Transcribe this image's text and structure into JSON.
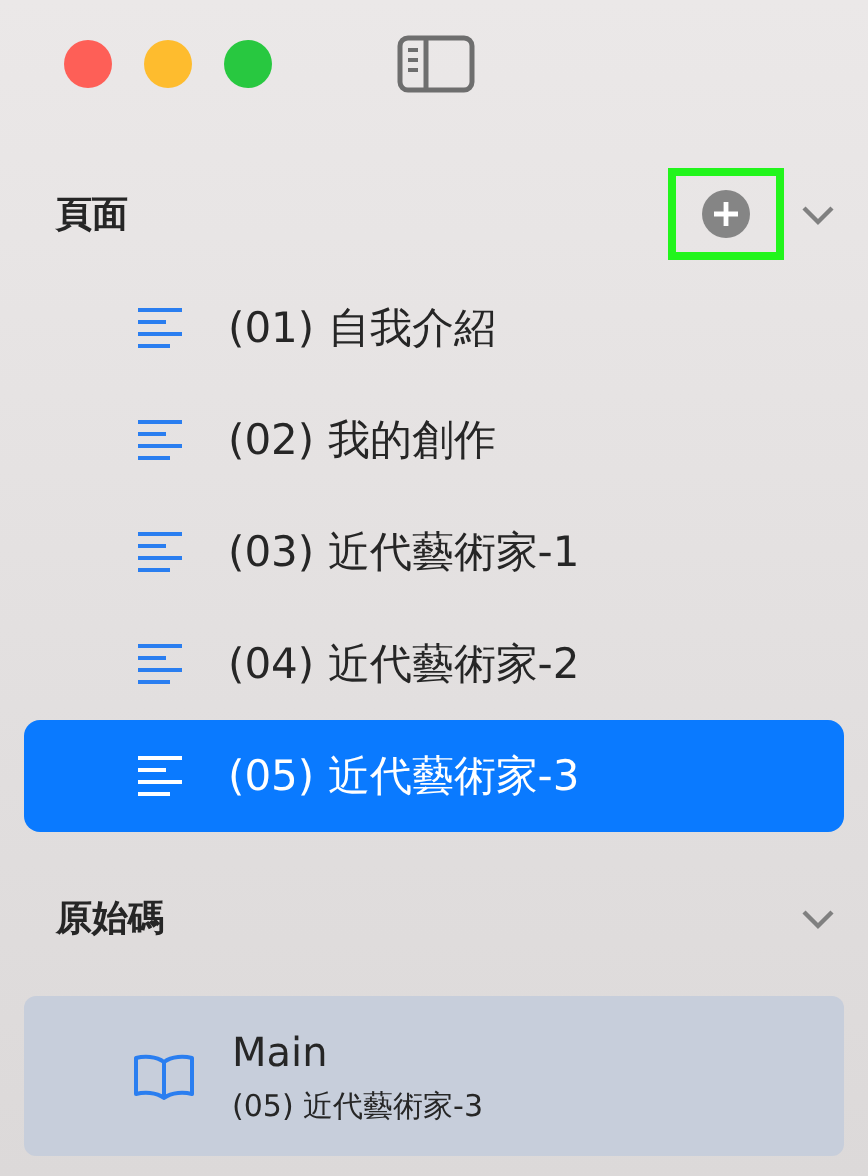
{
  "sections": [
    {
      "title": "頁面",
      "add_button": {
        "highlighted": true
      },
      "expanded": true,
      "items": [
        {
          "label": "(01) 自我介紹",
          "selected": false
        },
        {
          "label": "(02) 我的創作",
          "selected": false
        },
        {
          "label": "(03) 近代藝術家-1",
          "selected": false
        },
        {
          "label": "(04) 近代藝術家-2",
          "selected": false
        },
        {
          "label": "(05) 近代藝術家-3",
          "selected": true
        }
      ]
    },
    {
      "title": "原始碼",
      "expanded": true,
      "source": {
        "title": "Main",
        "subtitle": "(05) 近代藝術家-3"
      }
    }
  ]
}
